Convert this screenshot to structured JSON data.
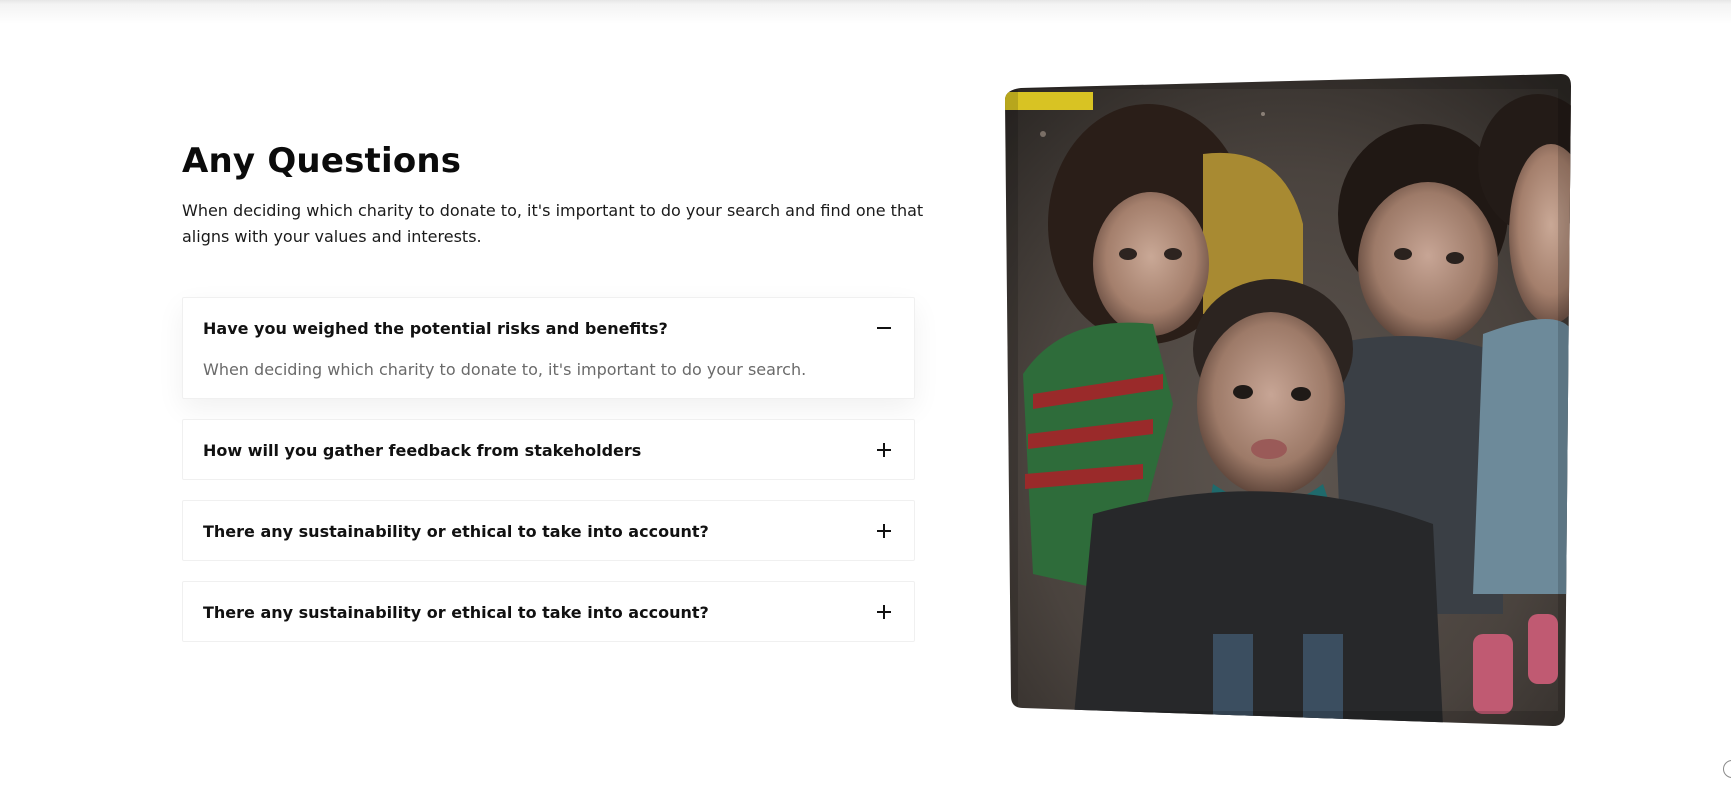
{
  "section": {
    "title": "Any Questions",
    "subtitle": "When deciding which charity to donate to, it's important to do your search and find one that aligns with your values and interests."
  },
  "faq": [
    {
      "question": "Have you weighed the potential risks and benefits?",
      "answer": "When deciding which charity to donate to, it's important to do your search.",
      "expanded": true,
      "toggle_icon": "minus-icon"
    },
    {
      "question": "How will you gather feedback from stakeholders",
      "expanded": false,
      "toggle_icon": "plus-icon"
    },
    {
      "question": "There any sustainability or ethical to take into account?",
      "expanded": false,
      "toggle_icon": "plus-icon"
    },
    {
      "question": "There any sustainability or ethical to take into account?",
      "expanded": false,
      "toggle_icon": "plus-icon"
    }
  ],
  "image": {
    "subject": "children-photo"
  },
  "colors": {
    "text": "#0b0b0b",
    "muted": "#6a6a6a",
    "border": "#f0f0f0",
    "background": "#ffffff"
  }
}
